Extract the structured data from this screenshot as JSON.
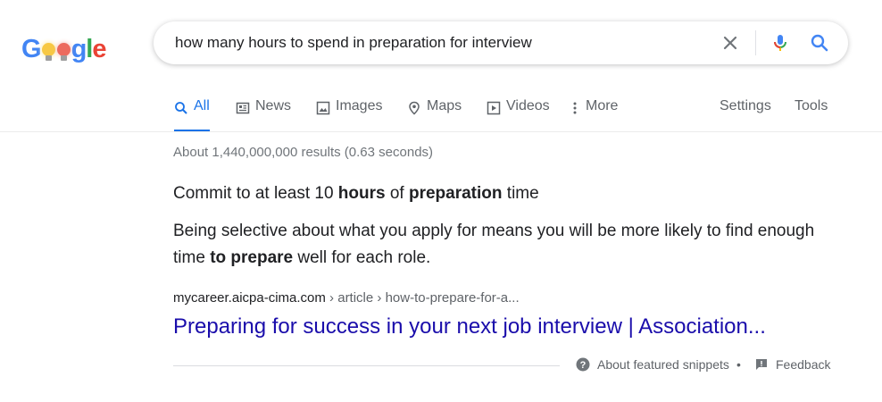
{
  "logo": {
    "g1": "G",
    "g2": "g",
    "l": "l",
    "e": "e"
  },
  "search": {
    "query": "how many hours to spend in preparation for interview",
    "clear_icon": "close-icon",
    "mic_icon": "mic-icon",
    "search_icon": "search-icon"
  },
  "tabs": [
    {
      "label": "All",
      "icon": "search-icon",
      "active": true
    },
    {
      "label": "News",
      "icon": "news-icon"
    },
    {
      "label": "Images",
      "icon": "image-icon"
    },
    {
      "label": "Maps",
      "icon": "map-pin-icon"
    },
    {
      "label": "Videos",
      "icon": "video-icon"
    },
    {
      "label": "More",
      "icon": "more-vert-icon"
    },
    {
      "label": "Settings"
    },
    {
      "label": "Tools"
    }
  ],
  "stats": "About 1,440,000,000 results (0.63 seconds)",
  "snippet": {
    "title_pre": "Commit to at least 10 ",
    "title_b1": "hours",
    "title_mid": " of ",
    "title_b2": "preparation",
    "title_post": " time",
    "body_pre": "Being selective about what you apply for means you will be more likely to find enough time ",
    "body_b": "to prepare",
    "body_post": " well for each role."
  },
  "citation": {
    "domain": "mycareer.aicpa-cima.com",
    "path": " › article › how-to-prepare-for-a..."
  },
  "result_title": "Preparing for success in your next job interview | Association...",
  "footer": {
    "about": "About featured snippets",
    "dot": "•",
    "feedback": "Feedback"
  },
  "colors": {
    "link": "#1a0dab",
    "active_tab": "#1a73e8",
    "muted": "#5f6368"
  }
}
